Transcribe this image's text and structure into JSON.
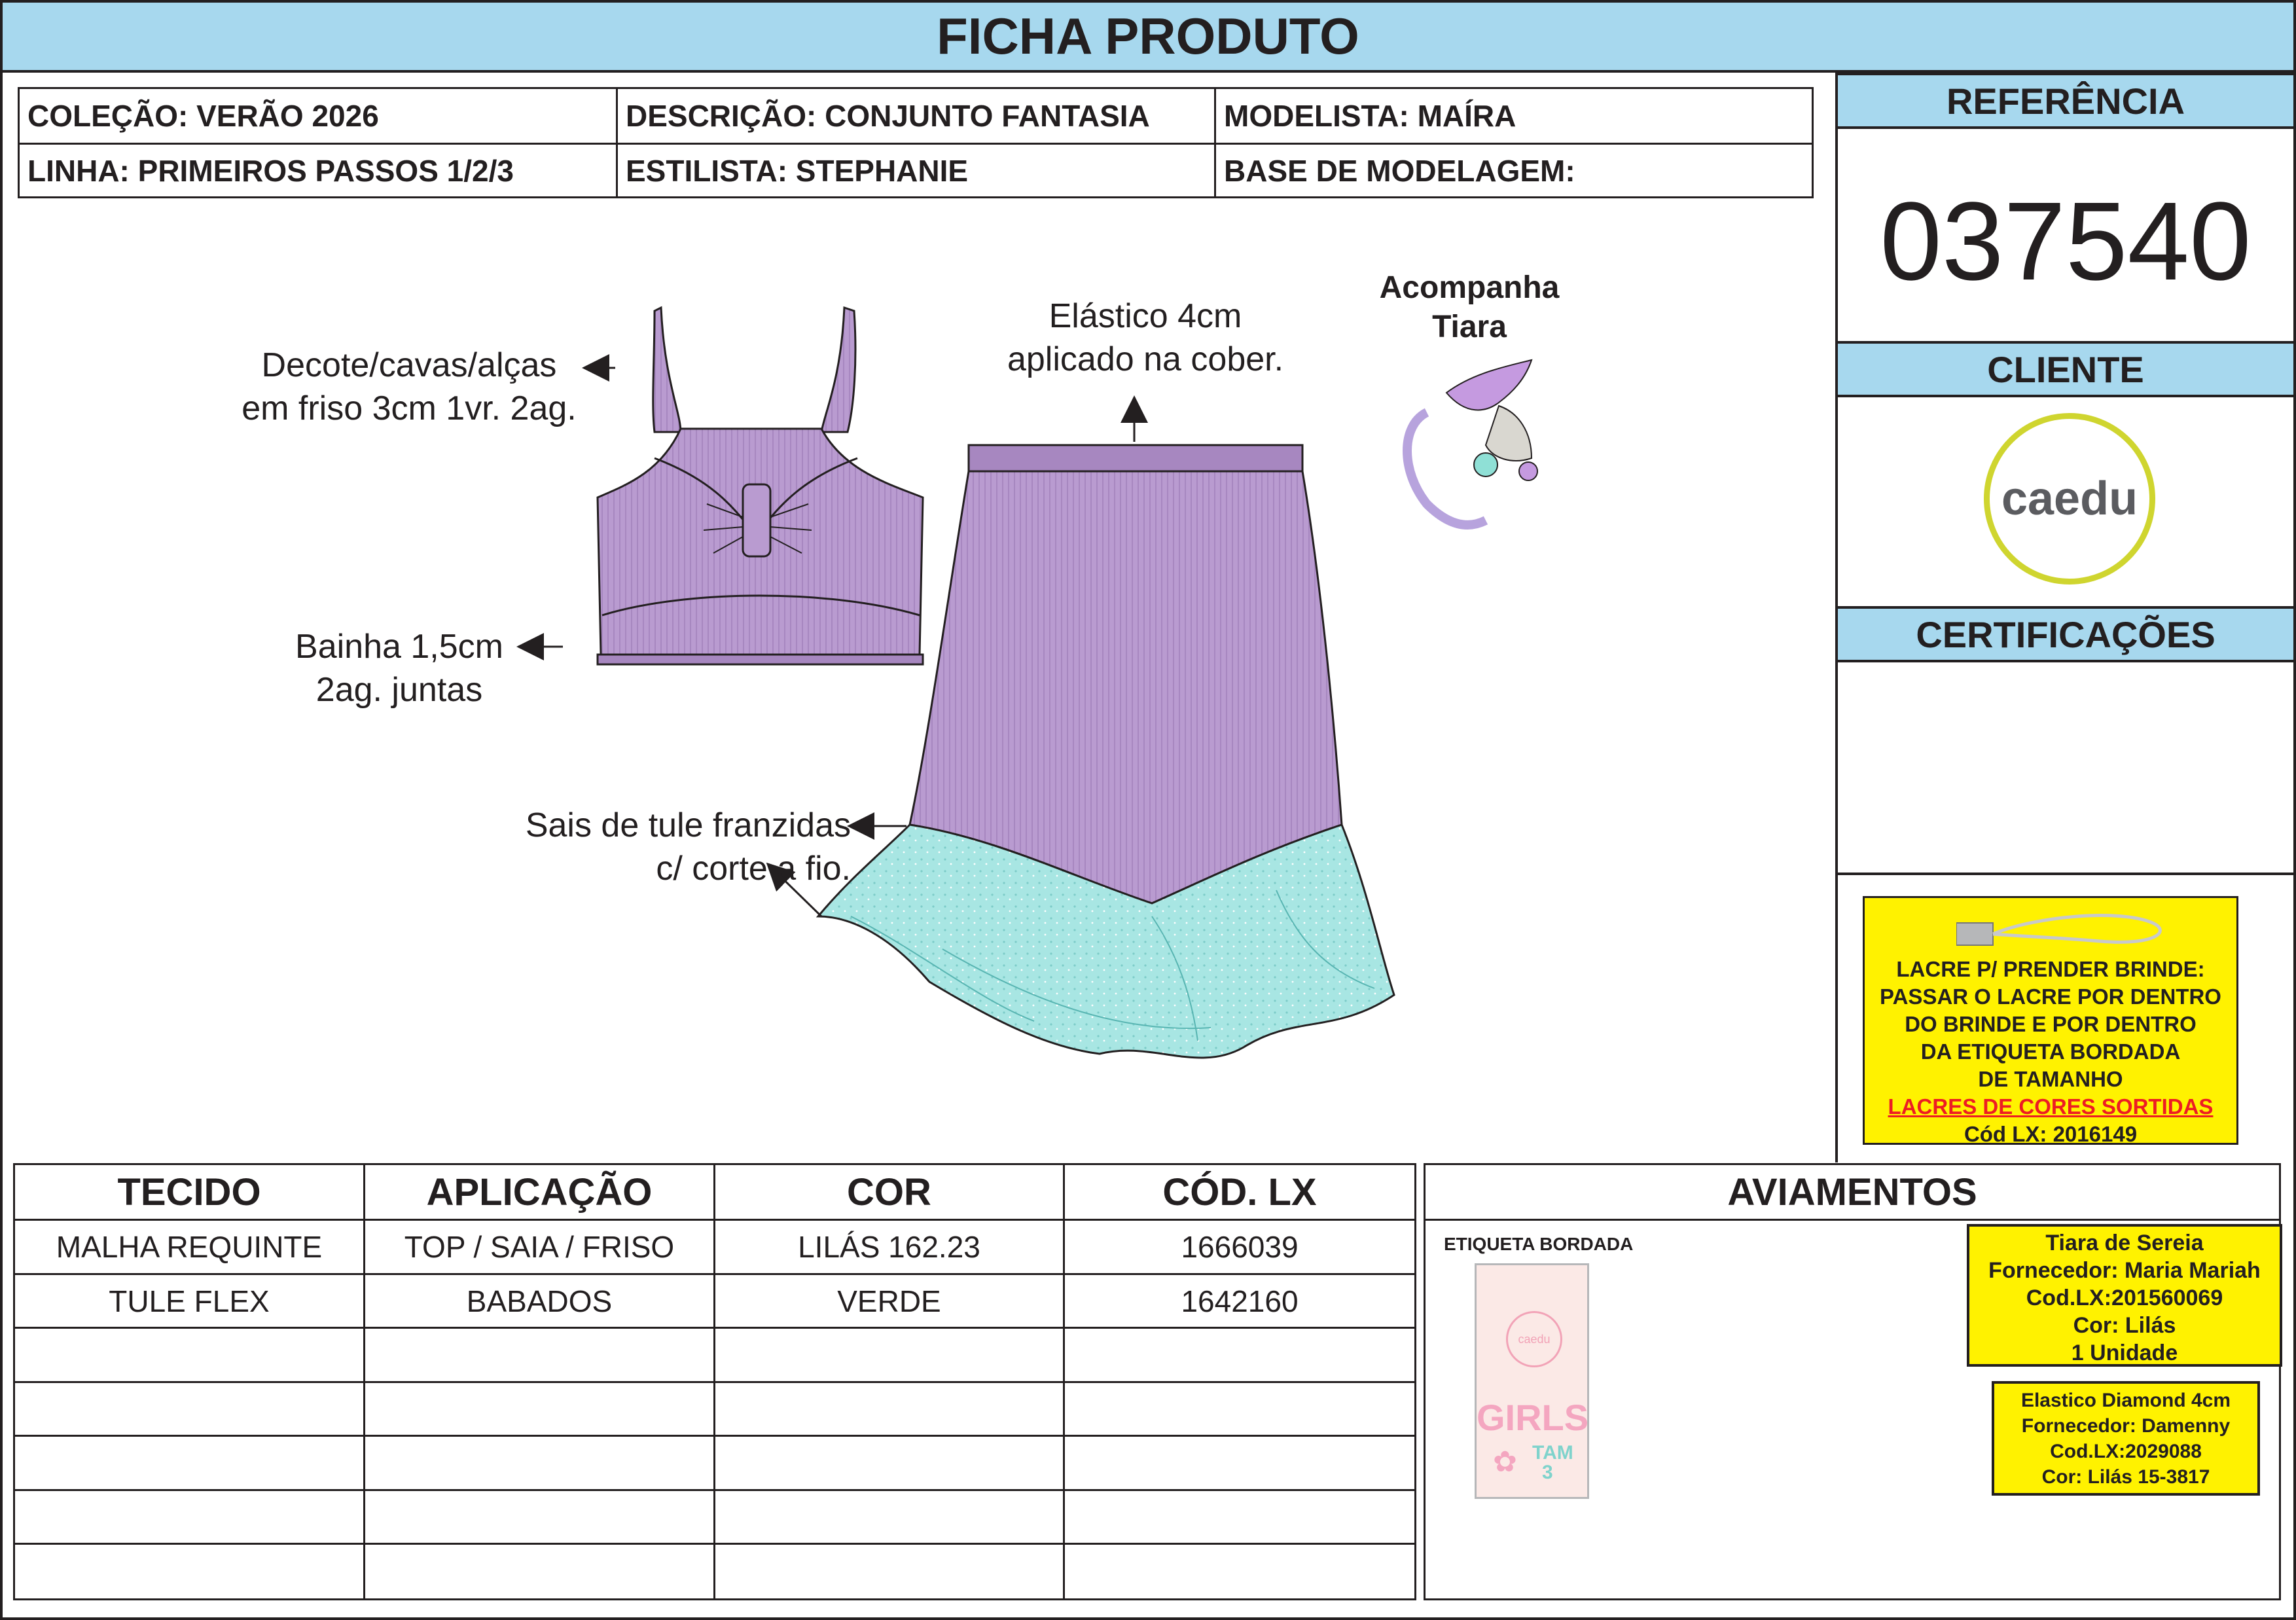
{
  "header": {
    "title": "FICHA PRODUTO"
  },
  "info": {
    "colecao": "COLEÇÃO: VERÃO 2026",
    "descricao": "DESCRIÇÃO: CONJUNTO FANTASIA",
    "modelista": "MODELISTA: MAÍRA",
    "linha": "LINHA: PRIMEIROS PASSOS 1/2/3",
    "estilista": "ESTILISTA: STEPHANIE",
    "base": "BASE DE MODELAGEM:"
  },
  "side": {
    "referencia_label": "REFERÊNCIA",
    "referencia_value": "037540",
    "cliente_label": "CLIENTE",
    "cliente_logo": "caedu",
    "certificacoes_label": "CERTIFICAÇÕES",
    "lacre": {
      "lines": [
        "LACRE P/ PRENDER BRINDE:",
        "PASSAR O LACRE POR DENTRO",
        "DO BRINDE E POR DENTRO",
        "DA ETIQUETA BORDADA",
        "DE TAMANHO"
      ],
      "highlight": "LACRES DE CORES SORTIDAS",
      "code": "Cód LX: 2016149"
    }
  },
  "annotations": {
    "decote": [
      "Decote/cavas/alças",
      "em friso 3cm 1vr. 2ag."
    ],
    "bainha": [
      "Bainha 1,5cm",
      "2ag. juntas"
    ],
    "elastico": [
      "Elástico 4cm",
      "aplicado na cober."
    ],
    "sais": [
      "Sais de tule franzidas",
      "c/ corte a fio."
    ],
    "tiara": [
      "Acompanha",
      "Tiara"
    ]
  },
  "materials": {
    "headers": [
      "TECIDO",
      "APLICAÇÃO",
      "COR",
      "CÓD. LX"
    ],
    "rows": [
      [
        "MALHA REQUINTE",
        "TOP / SAIA / FRISO",
        "LILÁS 162.23",
        "1666039"
      ],
      [
        "TULE FLEX",
        "BABADOS",
        "VERDE",
        "1642160"
      ]
    ]
  },
  "aviamentos": {
    "title": "AVIAMENTOS",
    "etiqueta_label": "ETIQUETA BORDADA",
    "label_art": {
      "logo": "caedu",
      "girls": "GIRLS",
      "tam": "TAM",
      "size": "3"
    },
    "tiara_box": [
      "Tiara de Sereia",
      "Fornecedor: Maria Mariah",
      "Cod.LX:201560069",
      "Cor: Lilás",
      "1 Unidade"
    ],
    "elastico_box": [
      "Elastico Diamond 4cm",
      "Fornecedor: Damenny",
      "Cod.LX:2029088",
      "Cor: Lilás 15-3817"
    ]
  },
  "colors": {
    "header_blue": "#a7d8ee",
    "lilac": "#b99bd0",
    "tulle": "#a8e6e3",
    "yellow": "#fff200",
    "logo_ring": "#cfd52f",
    "red_text": "#ed1c24"
  }
}
